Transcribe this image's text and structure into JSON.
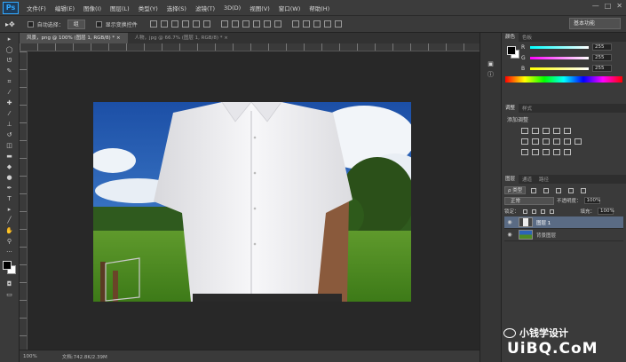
{
  "app": {
    "logo": "Ps"
  },
  "menu": [
    "文件(F)",
    "编辑(E)",
    "图像(I)",
    "图层(L)",
    "类型(Y)",
    "选择(S)",
    "滤镜(T)",
    "3D(D)",
    "视图(V)",
    "窗口(W)",
    "帮助(H)"
  ],
  "window_controls": {
    "min": "—",
    "max": "□",
    "close": "✕"
  },
  "options": {
    "auto_select": "自动选择：",
    "select_value": "组",
    "show_transform": "显示变换控件",
    "workspace": "基本功能"
  },
  "tabs": [
    {
      "label": "风景，png @ 100% (图层 1, RGB/8) *",
      "close": "×"
    },
    {
      "label": "人物，jpg @ 66.7% (图层 1, RGB/8) *",
      "close": "×"
    }
  ],
  "status": {
    "zoom": "100%",
    "doc": "文档:742.8K/2.39M"
  },
  "color_panel": {
    "tabs": [
      "颜色",
      "色板"
    ],
    "r_label": "R",
    "g_label": "G",
    "b_label": "B",
    "r_value": "255",
    "g_value": "255",
    "b_value": "255"
  },
  "adjust_panel": {
    "tabs": [
      "调整",
      "样式"
    ],
    "title": "添加调整"
  },
  "layers_panel": {
    "tabs": [
      "图层",
      "通道",
      "路径"
    ],
    "filter": "ρ 类型",
    "blend_mode": "正常",
    "opacity_label": "不透明度：",
    "opacity_value": "100%",
    "lock_label": "锁定：",
    "fill_label": "填充：",
    "fill_value": "100%",
    "layers": [
      {
        "name": "图层 1",
        "selected": true
      },
      {
        "name": "背景图层",
        "selected": false
      }
    ]
  },
  "watermark": {
    "title": "小钱学设计",
    "site": "UiBQ.CoM"
  }
}
